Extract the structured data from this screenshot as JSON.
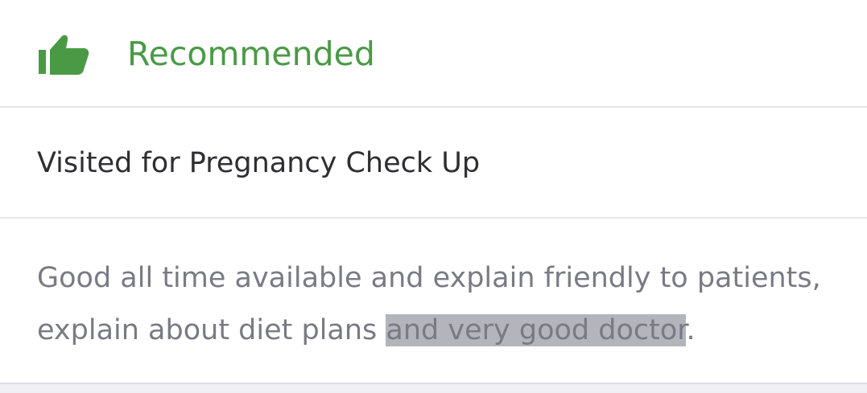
{
  "recommendation": {
    "icon": "thumbs-up-icon",
    "label": "Recommended",
    "color": "#4a9a45"
  },
  "visit": {
    "label": "Visited for Pregnancy Check Up"
  },
  "review": {
    "text_before": "Good all time available and explain friendly to patients, explain about diet plans ",
    "text_selected": "and very good doctor",
    "text_after": "."
  }
}
